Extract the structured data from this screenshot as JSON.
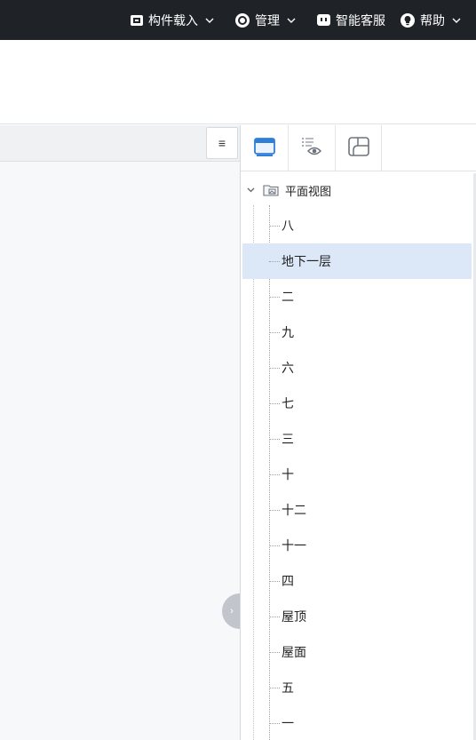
{
  "top_menu": [
    {
      "label": "构件载入",
      "icon": "component-load-icon"
    },
    {
      "label": "管理",
      "icon": "manage-gear-icon"
    },
    {
      "label": "智能客服",
      "icon": "chat-service-icon"
    },
    {
      "label": "帮助",
      "icon": "help-bulb-icon"
    }
  ],
  "left_panel": {
    "menu_icon": "≡"
  },
  "right_panel": {
    "tabs": [
      {
        "icon": "view-window-icon",
        "active": true
      },
      {
        "icon": "visibility-list-icon",
        "active": false
      },
      {
        "icon": "floor-plan-icon",
        "active": false
      }
    ],
    "tree": {
      "root_label": "平面视图",
      "selected_label": "地下一层",
      "items": [
        "八",
        "地下一层",
        "二",
        "九",
        "六",
        "七",
        "三",
        "十",
        "十二",
        "十一",
        "四",
        "屋顶",
        "屋面",
        "五",
        "一"
      ]
    }
  },
  "colors": {
    "topbar": "#1f2328",
    "selection": "#dce8f7",
    "accent": "#2f7fd8"
  }
}
